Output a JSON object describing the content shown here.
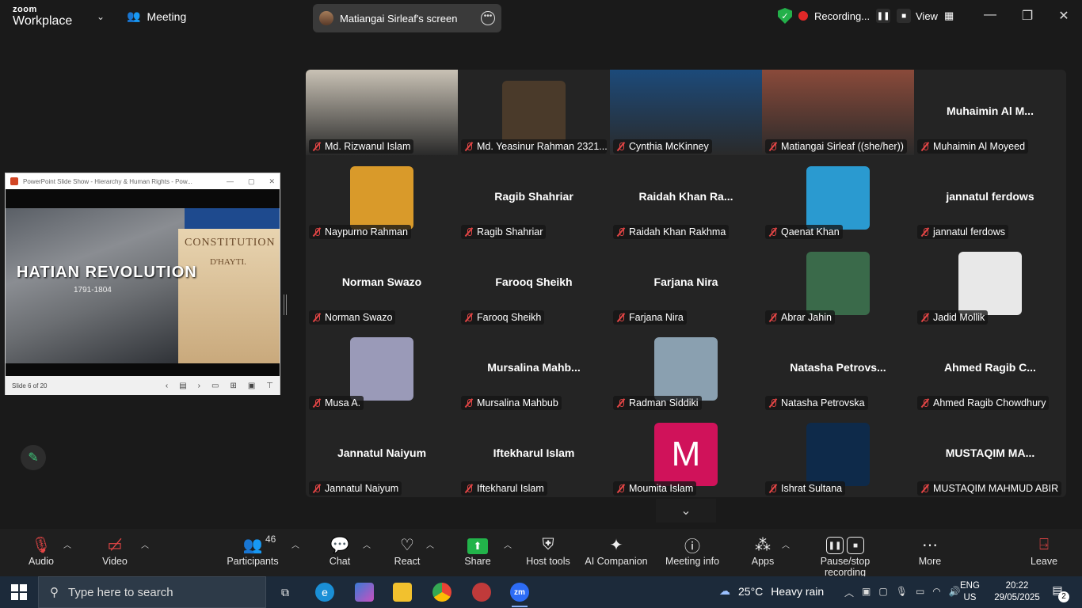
{
  "app": {
    "brand_top": "zoom",
    "brand_bottom": "Workplace",
    "meeting_label": "Meeting",
    "shared_screen": "Matiangai Sirleaf's screen",
    "recording_label": "Recording...",
    "view_label": "View"
  },
  "shared_slide": {
    "window_title": "PowerPoint Slide Show - Hierarchy & Human Rights - Pow...",
    "title": "HATIAN REVOLUTION",
    "years": "1791-1804",
    "doc_heading": "CONSTITUTION",
    "doc_sub": "D'HAYTI.",
    "status": "Slide 6 of 20"
  },
  "participants": [
    {
      "name": "Md. Rizwanul Islam",
      "video": "#c9c2b5"
    },
    {
      "name": "Md. Yeasinur Rahman 2321...",
      "avatar": "#4a3a2a"
    },
    {
      "name": "Cynthia McKinney",
      "video": "#1c4a7a"
    },
    {
      "name": "Matiangai Sirleaf ((she/her))",
      "video": "#8a4a3a",
      "speaking": true
    },
    {
      "name": "Muhaimin Al Moyeed",
      "big": "Muhaimin  Al  M..."
    },
    {
      "name": "Naypurno Rahman",
      "avatar": "#d99a2a"
    },
    {
      "name": "Ragib Shahriar",
      "big": "Ragib Shahriar"
    },
    {
      "name": "Raidah Khan Rakhma",
      "big": "Raidah  Khan  Ra..."
    },
    {
      "name": "Qaenat Khan",
      "avatar": "#2a9ad0"
    },
    {
      "name": "jannatul ferdows",
      "big": "jannatul ferdows"
    },
    {
      "name": "Norman Swazo",
      "big": "Norman Swazo"
    },
    {
      "name": "Farooq Sheikh",
      "big": "Farooq Sheikh"
    },
    {
      "name": "Farjana Nira",
      "big": "Farjana Nira"
    },
    {
      "name": "Abrar Jahin",
      "avatar": "#3a6a4a"
    },
    {
      "name": "Jadid Mollik",
      "avatar": "#e8e8e8"
    },
    {
      "name": "Musa A.",
      "avatar": "#9a9ab8"
    },
    {
      "name": "Mursalina Mahbub",
      "big": "Mursalina  Mahb..."
    },
    {
      "name": "Radman Siddiki",
      "avatar": "#8aa0b0"
    },
    {
      "name": "Natasha Petrovska",
      "big": "Natasha  Petrovs..."
    },
    {
      "name": "Ahmed Ragib Chowdhury",
      "big": "Ahmed  Ragib  C..."
    },
    {
      "name": "Jannatul Naiyum",
      "big": "Jannatul Naiyum"
    },
    {
      "name": "Iftekharul Islam",
      "big": "Iftekharul Islam"
    },
    {
      "name": "Moumita Islam",
      "letter": "M",
      "avatar": "#d0125a"
    },
    {
      "name": "Ishrat Sultana",
      "avatar": "#0e2a4a"
    },
    {
      "name": "MUSTAQIM MAHMUD ABIR",
      "big": "MUSTAQIM  MA..."
    }
  ],
  "toolbar": {
    "audio": "Audio",
    "video": "Video",
    "participants": "Participants",
    "participants_count": "46",
    "chat": "Chat",
    "react": "React",
    "share": "Share",
    "host_tools": "Host tools",
    "ai_companion": "AI Companion",
    "meeting_info": "Meeting info",
    "apps": "Apps",
    "pause_stop": "Pause/stop recording",
    "more": "More",
    "leave": "Leave"
  },
  "taskbar": {
    "search_placeholder": "Type here to search",
    "weather_temp": "25°C",
    "weather_desc": "Heavy rain",
    "lang_1": "ENG",
    "lang_2": "US",
    "time": "20:22",
    "date": "29/05/2025",
    "notifications": "2"
  }
}
